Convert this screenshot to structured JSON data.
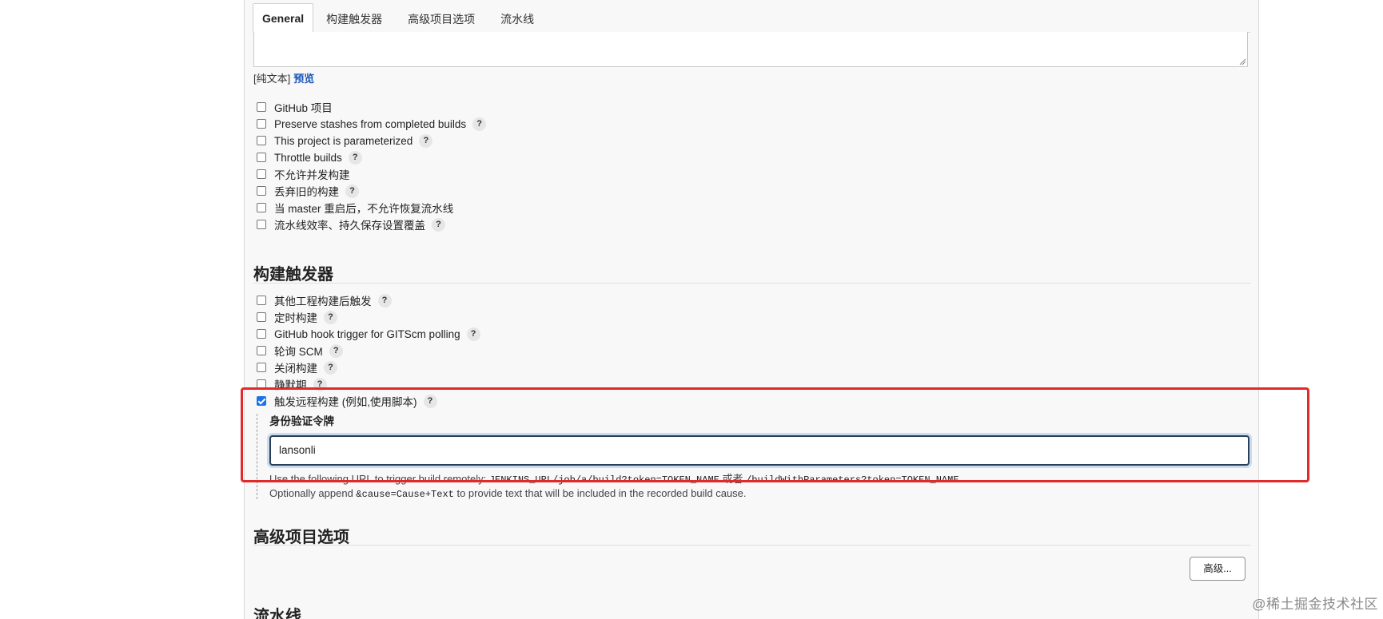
{
  "tabs": [
    {
      "label": "General",
      "active": true
    },
    {
      "label": "构建触发器",
      "active": false
    },
    {
      "label": "高级项目选项",
      "active": false
    },
    {
      "label": "流水线",
      "active": false
    }
  ],
  "description": {
    "plain_label": "[纯文本]",
    "preview_link": "预览"
  },
  "general_options": [
    {
      "label": "GitHub 项目",
      "checked": false,
      "help": false
    },
    {
      "label": "Preserve stashes from completed builds",
      "checked": false,
      "help": true
    },
    {
      "label": "This project is parameterized",
      "checked": false,
      "help": true
    },
    {
      "label": "Throttle builds",
      "checked": false,
      "help": true
    },
    {
      "label": "不允许并发构建",
      "checked": false,
      "help": false
    },
    {
      "label": "丢弃旧的构建",
      "checked": false,
      "help": true
    },
    {
      "label": "当 master 重启后，不允许恢复流水线",
      "checked": false,
      "help": false
    },
    {
      "label": "流水线效率、持久保存设置覆盖",
      "checked": false,
      "help": true
    }
  ],
  "triggers_section": {
    "title": "构建触发器"
  },
  "trigger_options": [
    {
      "label": "其他工程构建后触发",
      "checked": false,
      "help": true
    },
    {
      "label": "定时构建",
      "checked": false,
      "help": true
    },
    {
      "label": "GitHub hook trigger for GITScm polling",
      "checked": false,
      "help": true
    },
    {
      "label": "轮询 SCM",
      "checked": false,
      "help": true
    },
    {
      "label": "关闭构建",
      "checked": false,
      "help": true
    },
    {
      "label": "静默期",
      "checked": false,
      "help": true
    },
    {
      "label": "触发远程构建 (例如,使用脚本)",
      "checked": true,
      "help": true
    }
  ],
  "remote_trigger": {
    "token_label": "身份验证令牌",
    "token_value": "lansonli",
    "hint1_prefix": "Use the following URL to trigger build remotely: ",
    "hint1_url1": "JENKINS_URL/job/a/build?token=TOKEN_NAME",
    "hint1_or": " 或者 ",
    "hint1_url2": "/buildWithParameters?token=TOKEN_NAME",
    "hint2_prefix": "Optionally append ",
    "hint2_code": "&cause=Cause+Text",
    "hint2_suffix": " to provide text that will be included in the recorded build cause."
  },
  "advanced_section": {
    "title": "高级项目选项",
    "button_label": "高级..."
  },
  "pipeline_section": {
    "title": "流水线"
  },
  "help_glyph": "?",
  "watermark": "@稀土掘金技术社区",
  "colors": {
    "highlight": "#e02a2a",
    "link": "#1a56b7",
    "checkbox_checked": "#1a73e8"
  }
}
